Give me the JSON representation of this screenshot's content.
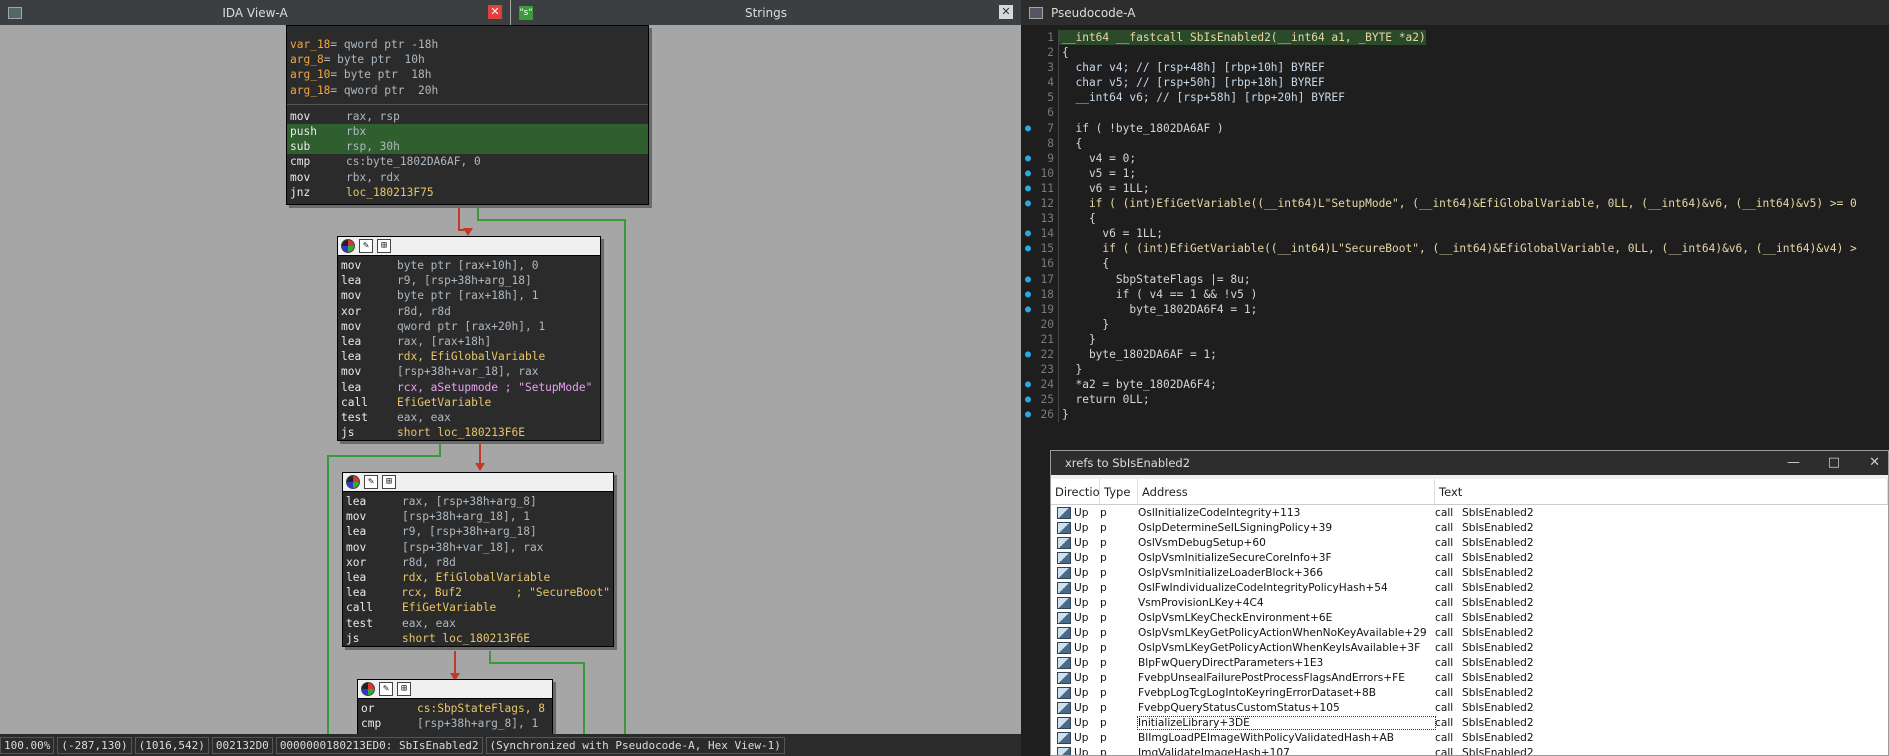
{
  "ida_panel": {
    "title": "IDA View-A",
    "strings_tab": "Strings",
    "strings_icon": "\"s\"",
    "node1": {
      "vars": [
        {
          "name": "var_18",
          "def": "= qword ptr -18h"
        },
        {
          "name": "arg_8",
          "def": "= byte ptr  10h"
        },
        {
          "name": "arg_10",
          "def": "= byte ptr  18h"
        },
        {
          "name": "arg_18",
          "def": "= qword ptr  20h"
        }
      ],
      "code": [
        {
          "op": "mov",
          "arg": "rax, rsp"
        },
        {
          "op": "push",
          "arg": "rbx"
        },
        {
          "op": "sub",
          "arg": "rsp, 30h"
        },
        {
          "op": "cmp",
          "arg": "cs:byte_1802DA6AF, 0"
        },
        {
          "op": "mov",
          "arg": "rbx, rdx"
        },
        {
          "op": "jnz",
          "arg": "loc_180213F75"
        }
      ]
    },
    "node2": [
      {
        "op": "mov",
        "arg": "byte ptr [rax+10h], 0"
      },
      {
        "op": "lea",
        "arg": "r9, [rsp+38h+arg_18]"
      },
      {
        "op": "mov",
        "arg": "byte ptr [rax+18h], 1"
      },
      {
        "op": "xor",
        "arg": "r8d, r8d"
      },
      {
        "op": "mov",
        "arg": "qword ptr [rax+20h], 1"
      },
      {
        "op": "lea",
        "arg": "rax, [rax+18h]"
      },
      {
        "op": "lea",
        "arg": "rdx, EfiGlobalVariable"
      },
      {
        "op": "mov",
        "arg": "[rsp+38h+var_18], rax"
      },
      {
        "op": "lea",
        "arg": "rcx, aSetupmode ; \"SetupMode\""
      },
      {
        "op": "call",
        "arg": "EfiGetVariable"
      },
      {
        "op": "test",
        "arg": "eax, eax"
      },
      {
        "op": "js",
        "arg": "short loc_180213F6E"
      }
    ],
    "node3": [
      {
        "op": "lea",
        "arg": "rax, [rsp+38h+arg_8]"
      },
      {
        "op": "mov",
        "arg": "[rsp+38h+arg_18], 1"
      },
      {
        "op": "lea",
        "arg": "r9, [rsp+38h+arg_18]"
      },
      {
        "op": "mov",
        "arg": "[rsp+38h+var_18], rax"
      },
      {
        "op": "xor",
        "arg": "r8d, r8d"
      },
      {
        "op": "lea",
        "arg": "rdx, EfiGlobalVariable"
      },
      {
        "op": "lea",
        "arg": "rcx, Buf2        ; \"SecureBoot\""
      },
      {
        "op": "call",
        "arg": "EfiGetVariable"
      },
      {
        "op": "test",
        "arg": "eax, eax"
      },
      {
        "op": "js",
        "arg": "short loc_180213F6E"
      }
    ],
    "node4": [
      {
        "op": "or",
        "arg": "cs:SbpStateFlags, 8"
      },
      {
        "op": "cmp",
        "arg": "[rsp+38h+arg_8], 1"
      }
    ],
    "status": [
      "100.00%",
      "(-287,130)",
      "(1016,542)",
      "002132D0",
      "0000000180213ED0: SbIsEnabled2",
      "(Synchronized with Pseudocode-A, Hex View-1)"
    ]
  },
  "pseudocode": {
    "title": "Pseudocode-A",
    "lines": [
      {
        "n": "1",
        "dot": false,
        "text": "__int64 __fastcall SbIsEnabled2(__int64 a1, _BYTE *a2)"
      },
      {
        "n": "2",
        "dot": false,
        "text": "{"
      },
      {
        "n": "3",
        "dot": false,
        "text": "  char v4; // [rsp+48h] [rbp+10h] BYREF"
      },
      {
        "n": "4",
        "dot": false,
        "text": "  char v5; // [rsp+50h] [rbp+18h] BYREF"
      },
      {
        "n": "5",
        "dot": false,
        "text": "  __int64 v6; // [rsp+58h] [rbp+20h] BYREF"
      },
      {
        "n": "6",
        "dot": false,
        "text": ""
      },
      {
        "n": "7",
        "dot": true,
        "text": "  if ( !byte_1802DA6AF )"
      },
      {
        "n": "8",
        "dot": false,
        "text": "  {"
      },
      {
        "n": "9",
        "dot": true,
        "text": "    v4 = 0;"
      },
      {
        "n": "10",
        "dot": true,
        "text": "    v5 = 1;"
      },
      {
        "n": "11",
        "dot": true,
        "text": "    v6 = 1LL;"
      },
      {
        "n": "12",
        "dot": true,
        "text": "    if ( (int)EfiGetVariable((__int64)L\"SetupMode\", (__int64)&EfiGlobalVariable, 0LL, (__int64)&v6, (__int64)&v5) >= 0"
      },
      {
        "n": "13",
        "dot": false,
        "text": "    {"
      },
      {
        "n": "14",
        "dot": true,
        "text": "      v6 = 1LL;"
      },
      {
        "n": "15",
        "dot": true,
        "text": "      if ( (int)EfiGetVariable((__int64)L\"SecureBoot\", (__int64)&EfiGlobalVariable, 0LL, (__int64)&v6, (__int64)&v4) >"
      },
      {
        "n": "16",
        "dot": false,
        "text": "      {"
      },
      {
        "n": "17",
        "dot": true,
        "text": "        SbpStateFlags |= 8u;"
      },
      {
        "n": "18",
        "dot": true,
        "text": "        if ( v4 == 1 && !v5 )"
      },
      {
        "n": "19",
        "dot": true,
        "text": "          byte_1802DA6F4 = 1;"
      },
      {
        "n": "20",
        "dot": false,
        "text": "      }"
      },
      {
        "n": "21",
        "dot": false,
        "text": "    }"
      },
      {
        "n": "22",
        "dot": true,
        "text": "    byte_1802DA6AF = 1;"
      },
      {
        "n": "23",
        "dot": false,
        "text": "  }"
      },
      {
        "n": "24",
        "dot": true,
        "text": "  *a2 = byte_1802DA6F4;"
      },
      {
        "n": "25",
        "dot": true,
        "text": "  return 0LL;"
      },
      {
        "n": "26",
        "dot": true,
        "text": "}"
      }
    ]
  },
  "xrefs": {
    "title": "xrefs to SbIsEnabled2",
    "controls": [
      "—",
      "□",
      "✕"
    ],
    "columns": [
      "Directio",
      "Type",
      "Address",
      "Text"
    ],
    "rows": [
      {
        "dir": "Up",
        "type": "p",
        "addr": "OslInitializeCodeIntegrity+113",
        "text": "SbIsEnabled2"
      },
      {
        "dir": "Up",
        "type": "p",
        "addr": "OslpDetermineSeILSigningPolicy+39",
        "text": "SbIsEnabled2"
      },
      {
        "dir": "Up",
        "type": "p",
        "addr": "OslVsmDebugSetup+60",
        "text": "SbIsEnabled2"
      },
      {
        "dir": "Up",
        "type": "p",
        "addr": "OslpVsmInitializeSecureCoreInfo+3F",
        "text": "SbIsEnabled2"
      },
      {
        "dir": "Up",
        "type": "p",
        "addr": "OslpVsmInitializeLoaderBlock+366",
        "text": "SbIsEnabled2"
      },
      {
        "dir": "Up",
        "type": "p",
        "addr": "OslFwIndividualizeCodeIntegrityPolicyHash+54",
        "text": "SbIsEnabled2"
      },
      {
        "dir": "Up",
        "type": "p",
        "addr": "VsmProvisionLKey+4C4",
        "text": "SbIsEnabled2"
      },
      {
        "dir": "Up",
        "type": "p",
        "addr": "OslpVsmLKeyCheckEnvironment+6E",
        "text": "SbIsEnabled2"
      },
      {
        "dir": "Up",
        "type": "p",
        "addr": "OslpVsmLKeyGetPolicyActionWhenNoKeyAvailable+29",
        "text": "SbIsEnabled2"
      },
      {
        "dir": "Up",
        "type": "p",
        "addr": "OslpVsmLKeyGetPolicyActionWhenKeyIsAvailable+3F",
        "text": "SbIsEnabled2"
      },
      {
        "dir": "Up",
        "type": "p",
        "addr": "BlpFwQueryDirectParameters+1E3",
        "text": "SbIsEnabled2"
      },
      {
        "dir": "Up",
        "type": "p",
        "addr": "FvebpUnsealFailurePostProcessFlagsAndErrors+FE",
        "text": "SbIsEnabled2"
      },
      {
        "dir": "Up",
        "type": "p",
        "addr": "FvebpLogTcgLogIntoKeyringErrorDataset+8B",
        "text": "SbIsEnabled2"
      },
      {
        "dir": "Up",
        "type": "p",
        "addr": "FvebpQueryStatusCustomStatus+105",
        "text": "SbIsEnabled2"
      },
      {
        "dir": "Up",
        "type": "p",
        "addr": "InitializeLibrary+3DE",
        "text": "SbIsEnabled2",
        "selected": true
      },
      {
        "dir": "Up",
        "type": "p",
        "addr": "BlImgLoadPEImageWithPolicyValidatedHash+AB",
        "text": "SbIsEnabled2"
      },
      {
        "dir": "Up",
        "type": "p",
        "addr": "ImgValidateImageHash+107",
        "text": "SbIsEnabled2"
      }
    ],
    "call_label": "call"
  }
}
